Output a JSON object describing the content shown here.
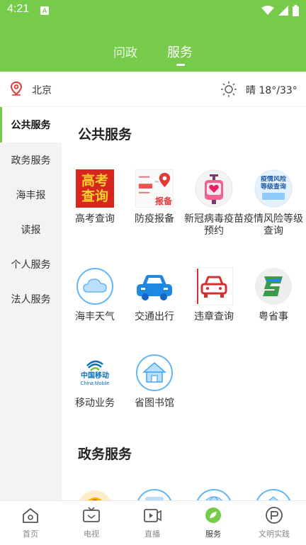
{
  "status_bar": {
    "time": "4:21",
    "notif_glyph": "A"
  },
  "top_tabs": [
    {
      "label": "问政"
    },
    {
      "label": "服务"
    }
  ],
  "location": {
    "city": "北京",
    "weather": "晴 18°/33°"
  },
  "sidebar": {
    "items": [
      {
        "label": "公共服务"
      },
      {
        "label": "政务服务"
      },
      {
        "label": "海丰报"
      },
      {
        "label": "读报"
      },
      {
        "label": "个人服务"
      },
      {
        "label": "法人服务"
      }
    ]
  },
  "sections": [
    {
      "title": "公共服务",
      "items": [
        {
          "label": "高考查询",
          "icon": "gaokao-icon",
          "icon_text": "高考查询"
        },
        {
          "label": "防疫报备",
          "icon": "epidemic-report-icon",
          "icon_text": "报备"
        },
        {
          "label": "新冠病毒疫苗预约",
          "icon": "vaccine-icon"
        },
        {
          "label": "疫情风险等级查询",
          "icon": "risk-level-icon",
          "icon_text": "疫情风险等级查询"
        },
        {
          "label": "海丰天气",
          "icon": "cloud-icon"
        },
        {
          "label": "交通出行",
          "icon": "car-icon"
        },
        {
          "label": "违章查询",
          "icon": "violation-car-icon"
        },
        {
          "label": "粤省事",
          "icon": "yueshengshi-icon"
        },
        {
          "label": "移动业务",
          "icon": "china-mobile-icon",
          "icon_text": "中国移动",
          "icon_subtext": "China Mobile"
        },
        {
          "label": "省图书馆",
          "icon": "library-icon"
        }
      ]
    },
    {
      "title": "政务服务",
      "items": []
    }
  ],
  "bottom_nav": [
    {
      "label": "首页",
      "icon": "home-icon"
    },
    {
      "label": "电视",
      "icon": "tv-icon"
    },
    {
      "label": "直播",
      "icon": "live-icon"
    },
    {
      "label": "服务",
      "icon": "service-icon"
    },
    {
      "label": "文明实践",
      "icon": "civilization-icon"
    }
  ],
  "colors": {
    "brand": "#76cc4a"
  }
}
